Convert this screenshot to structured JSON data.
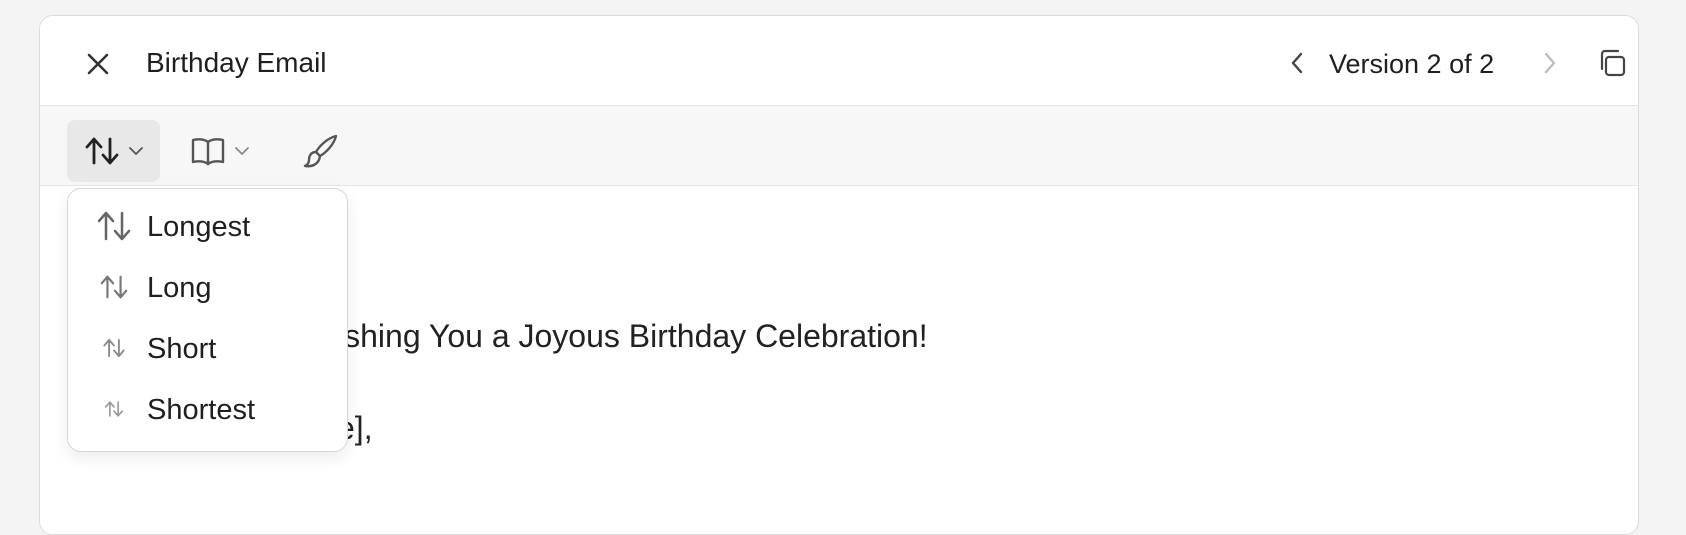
{
  "header": {
    "title": "Birthday Email",
    "version_label": "Version 2 of 2",
    "icons": {
      "close": "close-icon",
      "prev": "chevron-left-icon",
      "next": "chevron-right-icon",
      "copy": "copy-icon"
    }
  },
  "toolbar": {
    "length_icon": "sort-arrows-icon",
    "reading_icon": "book-icon",
    "polish_icon": "brush-icon"
  },
  "length_menu": {
    "items": [
      {
        "label": "Longest",
        "icon": "sort-arrows-icon"
      },
      {
        "label": "Long",
        "icon": "sort-arrows-icon"
      },
      {
        "label": "Short",
        "icon": "sort-arrows-icon"
      },
      {
        "label": "Shortest",
        "icon": "sort-arrows-icon"
      }
    ]
  },
  "content": {
    "lines": [
      "ishing You a Joyous Birthday Celebration!",
      "e],"
    ]
  },
  "colors": {
    "active_tool_bg": "#e8e8e8",
    "toolbar_bg": "#f7f7f7",
    "disabled_icon": "#bdbdbd"
  }
}
